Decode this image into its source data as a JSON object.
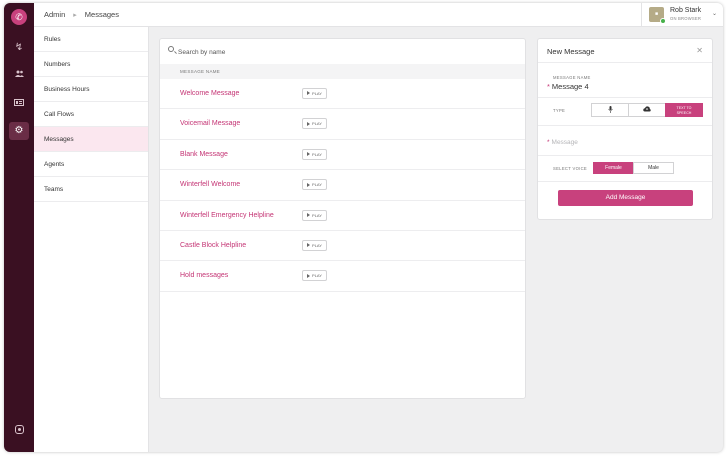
{
  "header": {
    "breadcrumb": [
      "Admin",
      "Messages"
    ],
    "user": {
      "name": "Rob Stark",
      "status": "ON BROWSER",
      "avatar_icon": "user-avatar",
      "chevron_icon": "chevron-down-icon"
    }
  },
  "rail": {
    "icons": [
      "phone-logo-icon",
      "lightning-icon",
      "people-icon",
      "id-card-icon",
      "gear-icon",
      "help-icon"
    ],
    "active": "gear-icon"
  },
  "subnav": {
    "items": [
      {
        "label": "Rules"
      },
      {
        "label": "Numbers"
      },
      {
        "label": "Business Hours"
      },
      {
        "label": "Call Flows"
      },
      {
        "label": "Messages"
      },
      {
        "label": "Agents"
      },
      {
        "label": "Teams"
      }
    ],
    "active_index": 4
  },
  "messages": {
    "search_placeholder": "Search by name",
    "column_header": "MESSAGE NAME",
    "play_label": "PLAY",
    "rows": [
      {
        "name": "Welcome Message"
      },
      {
        "name": "Voicemail Message"
      },
      {
        "name": "Blank Message"
      },
      {
        "name": "Winterfell Welcome"
      },
      {
        "name": "Winterfell Emergency Helpline"
      },
      {
        "name": "Castle Block Helpline"
      },
      {
        "name": "Hold messages"
      }
    ]
  },
  "new_message": {
    "title": "New Message",
    "close_icon": "close-icon",
    "name_label": "MESSAGE NAME",
    "name_value": "Message 4",
    "required_mark": "*",
    "type_label": "TYPE",
    "type_options": [
      {
        "icon": "microphone-icon"
      },
      {
        "icon": "upload-cloud-icon"
      },
      {
        "label_line1": "TEXT TO",
        "label_line2": "SPEECH"
      }
    ],
    "type_selected": 2,
    "message_placeholder": "Message",
    "voice_label": "SELECT VOICE",
    "voice_options": [
      "Female",
      "Male"
    ],
    "voice_selected": 0,
    "add_button": "Add Message"
  },
  "colors": {
    "accent": "#c8417d",
    "rail": "#3a1022",
    "link": "#c43474"
  }
}
